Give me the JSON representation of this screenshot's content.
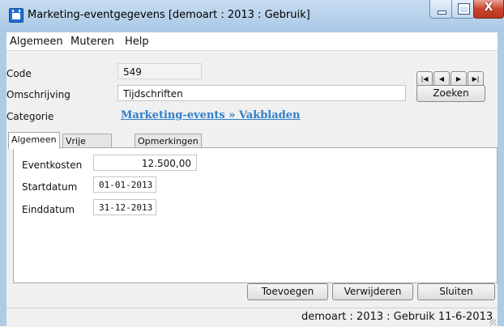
{
  "window": {
    "title": "Marketing-eventgegevens [demoart : 2013 : Gebruik]",
    "close_glyph": "X"
  },
  "menu": [
    {
      "label": "Algemeen"
    },
    {
      "label": "Muteren"
    },
    {
      "label": "Help"
    }
  ],
  "form": {
    "code_label": "Code",
    "code_value": "549",
    "omschrijving_label": "Omschrijving",
    "omschrijving_value": "Tijdschriften",
    "categorie_label": "Categorie",
    "categorie_link": "Marketing-events » Vakbladen"
  },
  "nav": {
    "first": "|◀",
    "prev": "◀",
    "next": "▶",
    "last": "▶|"
  },
  "buttons": {
    "zoeken": "Zoeken",
    "toevoegen": "Toevoegen",
    "verwijderen": "Verwijderen",
    "sluiten": "Sluiten"
  },
  "tabs": [
    {
      "label": "Algemeen",
      "active": true
    },
    {
      "label": "Vrije rubrieken",
      "active": false
    },
    {
      "label": "Opmerkingen",
      "active": false
    }
  ],
  "tab_fields": {
    "eventkosten_label": "Eventkosten",
    "eventkosten_value": "12.500,00",
    "startdatum_label": "Startdatum",
    "startdatum_value": "01-01-2013",
    "einddatum_label": "Einddatum",
    "einddatum_value": "31-12-2013"
  },
  "status": {
    "text": "demoart : 2013 : Gebruik  11-6-2013"
  }
}
